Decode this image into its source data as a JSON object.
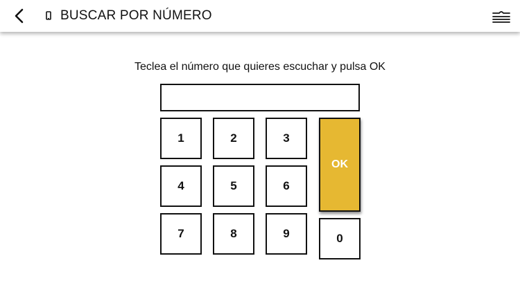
{
  "header": {
    "title": "BUSCAR POR NÚMERO",
    "back_icon": "chevron-left-icon",
    "phone_icon": "mobile-phone-icon",
    "menu_icon": "menu-icon"
  },
  "instruction": "Teclea el número que quieres escuchar y pulsa OK",
  "number_input": {
    "value": "",
    "placeholder": ""
  },
  "keypad": {
    "k1": "1",
    "k2": "2",
    "k3": "3",
    "k4": "4",
    "k5": "5",
    "k6": "6",
    "k7": "7",
    "k8": "8",
    "k9": "9",
    "k0": "0",
    "ok": "OK"
  },
  "colors": {
    "ok_button": "#e6b832",
    "ok_text": "#ffffff",
    "border": "#111111"
  }
}
